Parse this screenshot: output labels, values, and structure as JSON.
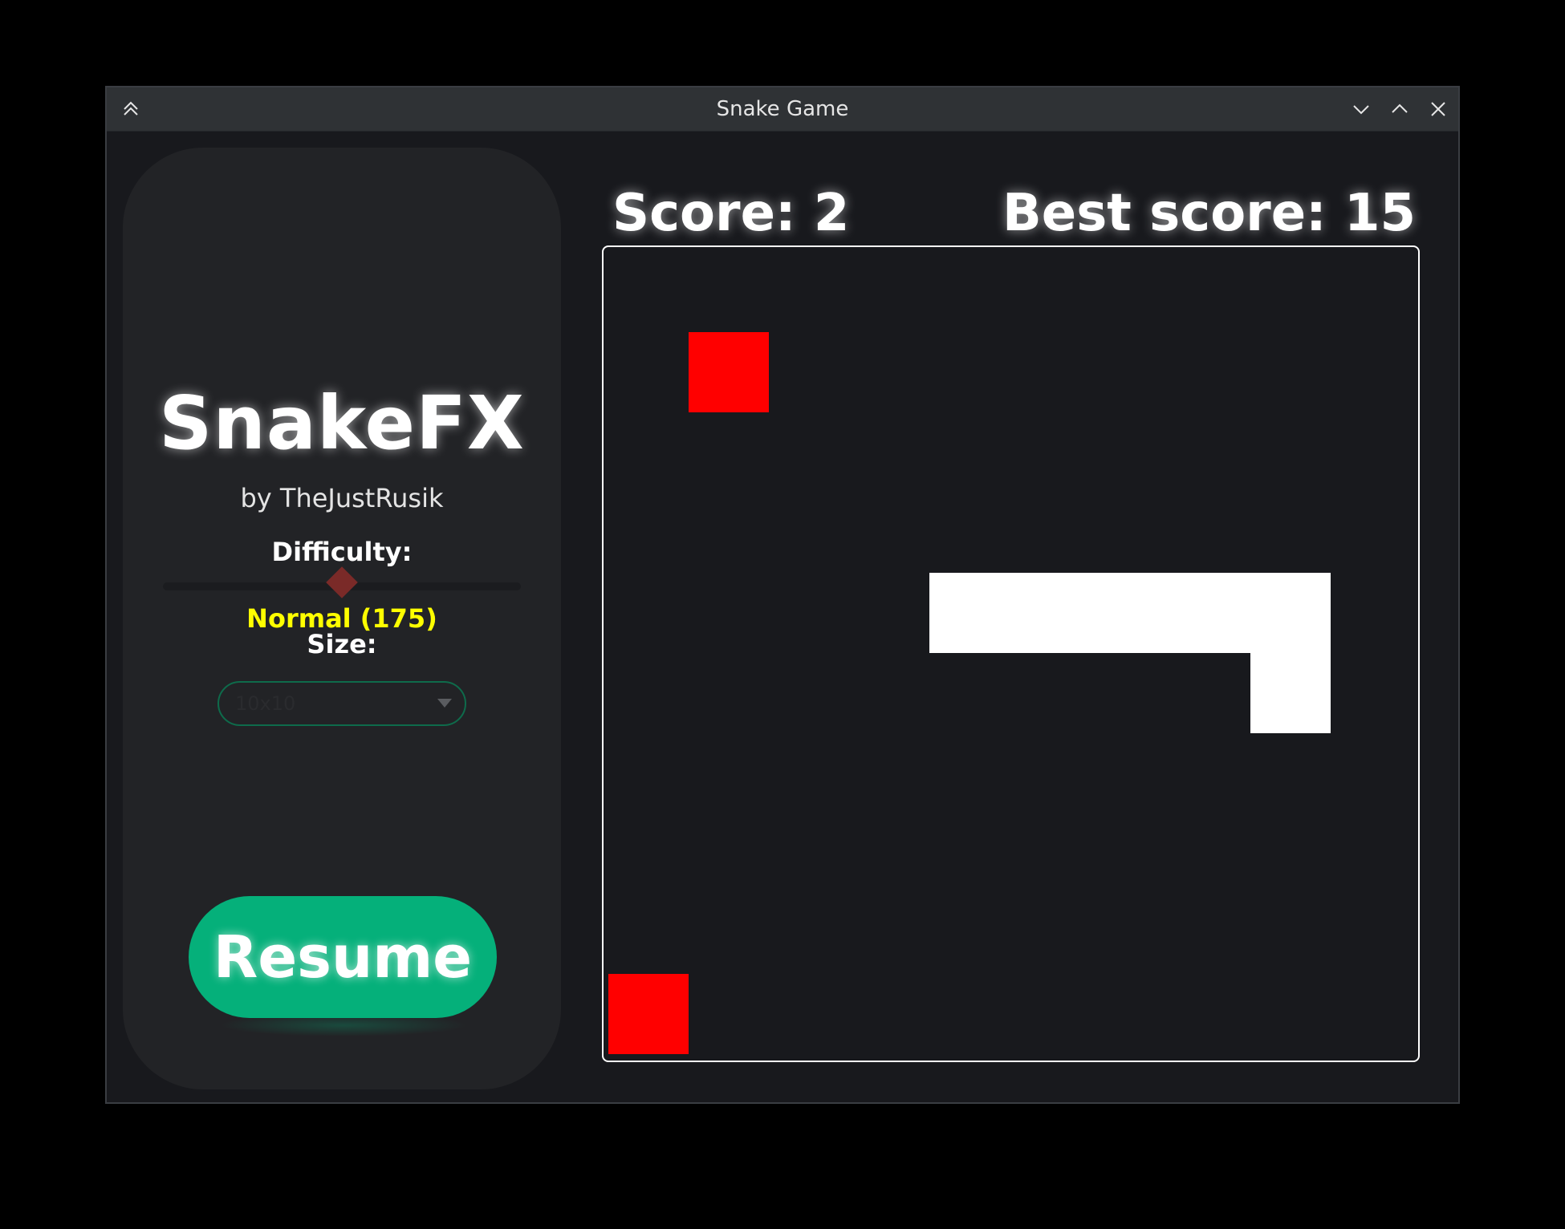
{
  "window": {
    "title": "Snake Game",
    "controls": [
      "keep-above",
      "minimize",
      "maximize",
      "close"
    ]
  },
  "sidebar": {
    "brand": "SnakeFX",
    "author": "by TheJustRusik",
    "difficulty_label": "Difficulty:",
    "difficulty_value_text": "Normal (175)",
    "difficulty_slider_fraction": 0.5,
    "size_label": "Size:",
    "size_selected": "10x10",
    "resume_label": "Resume"
  },
  "scores": {
    "score_text": "Score: 2",
    "best_score_text": "Best score: 15"
  },
  "board": {
    "grid": [
      10,
      10
    ],
    "snake": [
      [
        4,
        4
      ],
      [
        5,
        4
      ],
      [
        6,
        4
      ],
      [
        7,
        4
      ],
      [
        8,
        4
      ],
      [
        8,
        5
      ]
    ],
    "food": [
      [
        1,
        1
      ],
      [
        0,
        9
      ]
    ],
    "colors": {
      "snake": "#ffffff",
      "food": "#ff0000",
      "background": "#18191d",
      "border": "#ffffff"
    }
  },
  "colors": {
    "accent_green": "#05b07a",
    "difficulty_text": "#ffff00",
    "slider_thumb": "#7a2a28"
  }
}
